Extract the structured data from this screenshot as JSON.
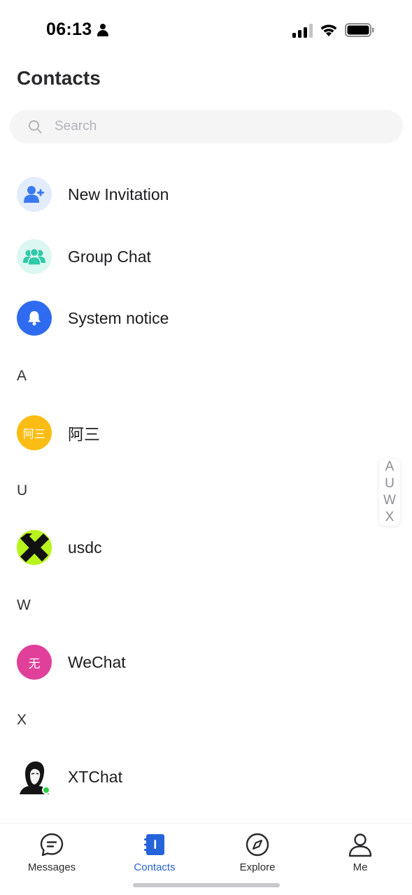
{
  "status": {
    "time": "06:13"
  },
  "header": {
    "title": "Contacts"
  },
  "search": {
    "placeholder": "Search"
  },
  "functions": [
    {
      "label": "New Invitation",
      "icon": "add-user-icon"
    },
    {
      "label": "Group Chat",
      "icon": "group-icon"
    },
    {
      "label": "System notice",
      "icon": "bell-icon"
    }
  ],
  "sections": [
    {
      "letter": "A",
      "contacts": [
        {
          "name": "阿三",
          "avatar_text": "阿三"
        }
      ]
    },
    {
      "letter": "U",
      "contacts": [
        {
          "name": "usdc",
          "avatar_text": ""
        }
      ]
    },
    {
      "letter": "W",
      "contacts": [
        {
          "name": "WeChat",
          "avatar_text": "无"
        }
      ]
    },
    {
      "letter": "X",
      "contacts": [
        {
          "name": "XTChat",
          "avatar_text": ""
        }
      ]
    }
  ],
  "index": [
    "A",
    "U",
    "W",
    "X"
  ],
  "tabs": [
    {
      "label": "Messages",
      "icon": "chat-bubble-icon",
      "active": false
    },
    {
      "label": "Contacts",
      "icon": "contacts-book-icon",
      "active": true
    },
    {
      "label": "Explore",
      "icon": "compass-icon",
      "active": false
    },
    {
      "label": "Me",
      "icon": "person-icon",
      "active": false
    }
  ],
  "colors": {
    "accent": "#2563d8",
    "notice": "#2f6bf0",
    "asan": "#fbbd13",
    "usdc": "#b8f31d",
    "wechat": "#e0409a",
    "online": "#2ecc40"
  }
}
